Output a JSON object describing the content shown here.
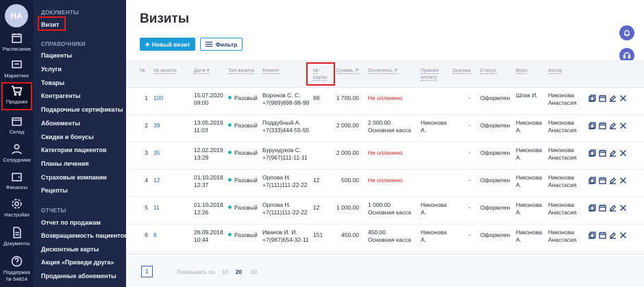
{
  "rail": {
    "avatar": "НА",
    "items": [
      {
        "label": "Расписание",
        "icon": "calendar-icon"
      },
      {
        "label": "Маркетинг",
        "icon": "chat-icon"
      },
      {
        "label": "Продажи",
        "icon": "cart-icon"
      },
      {
        "label": "Склад",
        "icon": "box-icon"
      },
      {
        "label": "Сотрудники",
        "icon": "people-icon"
      },
      {
        "label": "Финансы",
        "icon": "wallet-icon"
      },
      {
        "label": "Настройки",
        "icon": "gear-icon"
      },
      {
        "label": "Документы",
        "icon": "document-icon"
      },
      {
        "label": "Поддержка",
        "icon": "help-icon"
      }
    ],
    "account": "№ 54824"
  },
  "submenu": {
    "sections": [
      {
        "title": "ДОКУМЕНТЫ",
        "items": [
          "Визит"
        ]
      },
      {
        "title": "СПРАВОЧНИКИ",
        "items": [
          "Пациенты",
          "Услуги",
          "Товары",
          "Контрагенты",
          "Подарочные сертификаты",
          "Абонементы",
          "Скидки и бонусы",
          "Категории пациентов",
          "Планы лечения",
          "Страховые компании",
          "Рецепты"
        ]
      },
      {
        "title": "ОТЧЕТЫ",
        "items": [
          "Отчет по продажам",
          "Возвращаемость пациентов",
          "Дисконтные карты",
          "Акция «Приведи друга»",
          "Проданные абонементы"
        ]
      }
    ]
  },
  "main": {
    "title": "Визиты",
    "new_button": "Новый визит",
    "filter_button": "Фильтр",
    "columns": {
      "no": "№",
      "visit_no": "№ визита",
      "date": "Дата ▾",
      "type": "Тип визита",
      "client": "Клиент",
      "card": "№ карты",
      "sum": "Сумма, Р",
      "paid": "Оплачено, Р",
      "accepted": "Принял оплату",
      "rating": "Оценка",
      "status": "Статус",
      "doctor": "Врач",
      "author": "Автор"
    },
    "rows": [
      {
        "n": "1",
        "visit": "100",
        "date1": "15.07.2020",
        "date2": "09:00",
        "type": "Разовый",
        "client1": "Воронов С. С.",
        "client2": "+7(989)898-98-98",
        "card": "98",
        "sum": "1 700.00",
        "paid1": "Не оплачено",
        "paid2": "",
        "paid_red": true,
        "acc1": "",
        "acc2": "",
        "rating": "-",
        "status": "Оформлен",
        "doc1": "Шпак И.",
        "doc2": "",
        "auth1": "Никонова",
        "auth2": "Анастасия"
      },
      {
        "n": "2",
        "visit": "39",
        "date1": "13.05.2019",
        "date2": "11:03",
        "type": "Разовый",
        "client1": "Поддубный А.",
        "client2": "+7(333)444-55-55",
        "card": "",
        "sum": "2 000.00",
        "paid1": "2 000.00",
        "paid2": "Основная касса",
        "paid_red": false,
        "acc1": "Никонова",
        "acc2": "А.",
        "rating": "-",
        "status": "Оформлен",
        "doc1": "Никонова",
        "doc2": "А.",
        "auth1": "Никонова",
        "auth2": "Анастасия"
      },
      {
        "n": "3",
        "visit": "35",
        "date1": "12.02.2019",
        "date2": "13:29",
        "type": "Разовый",
        "client1": "Бурундуков С.",
        "client2": "+7(967)111-11-11",
        "card": "",
        "sum": "2 000.00",
        "paid1": "Не оплачено",
        "paid2": "",
        "paid_red": true,
        "acc1": "",
        "acc2": "",
        "rating": "-",
        "status": "Оформлен",
        "doc1": "Никонова",
        "doc2": "А.",
        "auth1": "Никонова",
        "auth2": "Анастасия"
      },
      {
        "n": "4",
        "visit": "12",
        "date1": "01.10.2018",
        "date2": "12:37",
        "type": "Разовый",
        "client1": "Орлова Н.",
        "client2": "+7(111)111-22-22",
        "card": "12",
        "sum": "500.00",
        "paid1": "Не оплачено",
        "paid2": "",
        "paid_red": true,
        "acc1": "",
        "acc2": "",
        "rating": "-",
        "status": "Оформлен",
        "doc1": "Никонова",
        "doc2": "А.",
        "auth1": "Никонова",
        "auth2": "Анастасия"
      },
      {
        "n": "5",
        "visit": "11",
        "date1": "01.10.2018",
        "date2": "12:26",
        "type": "Разовый",
        "client1": "Орлова Н.",
        "client2": "+7(111)111-22-22",
        "card": "12",
        "sum": "1 000.00",
        "paid1": "1 000.00",
        "paid2": "Основная касса",
        "paid_red": false,
        "acc1": "Никонова",
        "acc2": "А.",
        "rating": "-",
        "status": "Оформлен",
        "doc1": "Никонова",
        "doc2": "А.",
        "auth1": "Никонова",
        "auth2": "Анастасия"
      },
      {
        "n": "6",
        "visit": "8",
        "date1": "26.09.2018",
        "date2": "10:44",
        "type": "Разовый",
        "client1": "Иванов И. И.",
        "client2": "+7(987)654-32-11",
        "card": "151",
        "sum": "450.00",
        "paid1": "450.00",
        "paid2": "Основная касса",
        "paid_red": false,
        "acc1": "Никонова",
        "acc2": "А.",
        "rating": "-",
        "status": "Оформлен",
        "doc1": "Никонова",
        "doc2": "А.",
        "auth1": "Никонова",
        "auth2": "Анастасия"
      }
    ],
    "pagination": {
      "page": "1",
      "show_label": "Показывать по:",
      "sizes": [
        "10",
        "20",
        "50"
      ],
      "selected": "20"
    }
  }
}
